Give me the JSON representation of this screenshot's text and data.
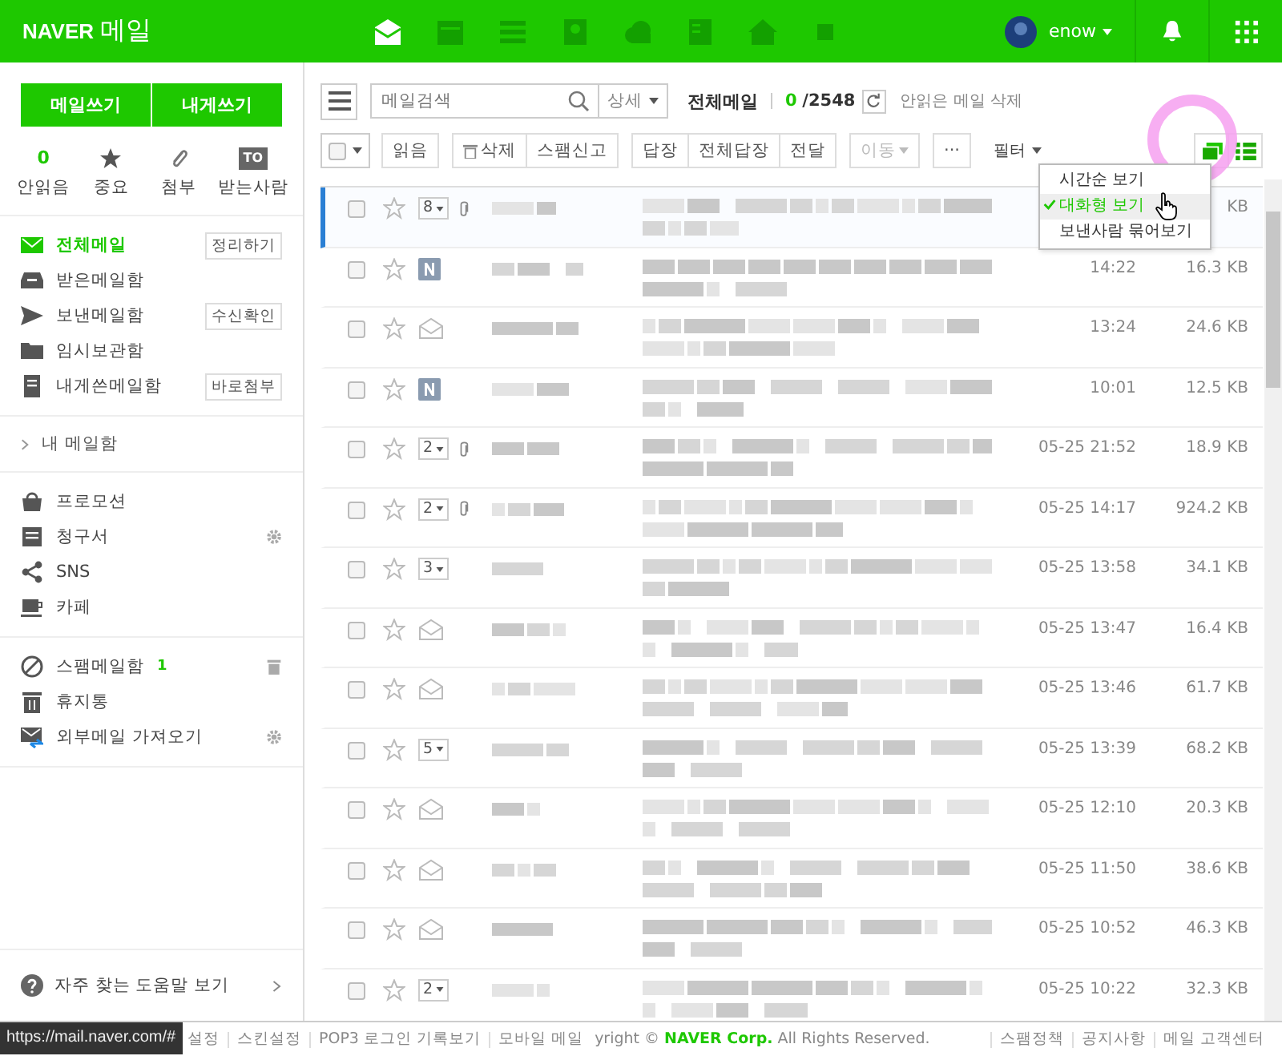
{
  "header": {
    "logo_brand": "NAVER",
    "logo_service": "메일",
    "apps": [
      {
        "kind": "mail",
        "selected": true
      },
      {
        "kind": "calendar",
        "selected": false
      },
      {
        "kind": "list",
        "selected": false
      },
      {
        "kind": "contacts",
        "selected": false
      },
      {
        "kind": "cloud",
        "selected": false
      },
      {
        "kind": "memo",
        "selected": false
      },
      {
        "kind": "home",
        "selected": false
      },
      {
        "kind": "more",
        "selected": false
      }
    ],
    "user": "enow"
  },
  "sidebar": {
    "compose": [
      "메일쓰기",
      "내게쓰기"
    ],
    "counters": [
      {
        "kind": "count",
        "value": "0",
        "label": "안읽음"
      },
      {
        "kind": "star",
        "label": "중요"
      },
      {
        "kind": "clip",
        "label": "첨부"
      },
      {
        "kind": "to",
        "value": "TO",
        "label": "받는사람"
      }
    ],
    "folders": [
      {
        "kind": "all",
        "label": "전체메일",
        "selected": true,
        "action": "정리하기"
      },
      {
        "kind": "inbox",
        "label": "받은메일함",
        "selected": false
      },
      {
        "kind": "sent",
        "label": "보낸메일함",
        "selected": false,
        "action": "수신확인"
      },
      {
        "kind": "draft",
        "label": "임시보관함",
        "selected": false
      },
      {
        "kind": "self",
        "label": "내게쓴메일함",
        "selected": false,
        "action": "바로첨부"
      }
    ],
    "my_folders": {
      "label": "내 메일함",
      "expanded": false
    },
    "categories": [
      {
        "kind": "bag",
        "label": "프로모션",
        "settings": false
      },
      {
        "kind": "bill",
        "label": "청구서",
        "settings": true
      },
      {
        "kind": "share",
        "label": "SNS",
        "settings": false
      },
      {
        "kind": "cup",
        "label": "카페",
        "settings": false
      }
    ],
    "extra": [
      {
        "kind": "spam",
        "label": "스팸메일함",
        "count": "1",
        "trash": true,
        "settings": false
      },
      {
        "kind": "trash",
        "label": "휴지통",
        "trash": false,
        "settings": false
      },
      {
        "kind": "import",
        "label": "외부메일 가져오기",
        "trash": false,
        "settings": true
      }
    ],
    "help": "자주 찾는 도움말 보기"
  },
  "toolbar": {
    "search_placeholder": "메일검색",
    "detail": "상세",
    "folder": "전체메일",
    "unread": "0",
    "total": "/2548",
    "delete_unread": "안읽은 메일 삭제",
    "actions": [
      {
        "kind": "plain",
        "label": "읽음",
        "disabled": false
      },
      {
        "kind": "trash",
        "label": "삭제",
        "disabled": false
      },
      {
        "kind": "plain",
        "label": "스팸신고",
        "disabled": false
      },
      {
        "kind": "plain",
        "label": "답장",
        "disabled": false
      },
      {
        "kind": "plain",
        "label": "전체답장",
        "disabled": false
      },
      {
        "kind": "plain",
        "label": "전달",
        "disabled": false
      },
      {
        "kind": "menu",
        "label": "이동",
        "disabled": true
      },
      {
        "kind": "plain",
        "label": "···",
        "disabled": false
      }
    ],
    "filter": "필터",
    "views": [
      {
        "kind": "conversation",
        "selected": true
      },
      {
        "kind": "list",
        "selected": false
      }
    ]
  },
  "view_menu": [
    {
      "label": "시간순 보기",
      "selected": false
    },
    {
      "label": "대화형 보기",
      "selected": true
    },
    {
      "label": "보낸사람 묶어보기",
      "selected": false
    }
  ],
  "rows": [
    {
      "kind": "thread",
      "count": "8",
      "attach": true,
      "date": "",
      "size": "KB",
      "selected": true
    },
    {
      "kind": "naver",
      "attach": false,
      "date": "14:22",
      "size": "16.3 KB",
      "selected": false
    },
    {
      "kind": "read",
      "attach": false,
      "date": "13:24",
      "size": "24.6 KB",
      "selected": false
    },
    {
      "kind": "naver",
      "attach": false,
      "date": "10:01",
      "size": "12.5 KB",
      "selected": false
    },
    {
      "kind": "thread",
      "count": "2",
      "attach": true,
      "date": "05-25 21:52",
      "size": "18.9 KB",
      "selected": false
    },
    {
      "kind": "thread",
      "count": "2",
      "attach": true,
      "date": "05-25 14:17",
      "size": "924.2 KB",
      "selected": false
    },
    {
      "kind": "thread",
      "count": "3",
      "attach": false,
      "date": "05-25 13:58",
      "size": "34.1 KB",
      "selected": false
    },
    {
      "kind": "read",
      "attach": false,
      "date": "05-25 13:47",
      "size": "16.4 KB",
      "selected": false
    },
    {
      "kind": "read",
      "attach": false,
      "date": "05-25 13:46",
      "size": "61.7 KB",
      "selected": false
    },
    {
      "kind": "thread",
      "count": "5",
      "attach": false,
      "date": "05-25 13:39",
      "size": "68.2 KB",
      "selected": false
    },
    {
      "kind": "read",
      "attach": false,
      "date": "05-25 12:10",
      "size": "20.3 KB",
      "selected": false
    },
    {
      "kind": "read",
      "attach": false,
      "date": "05-25 11:50",
      "size": "38.6 KB",
      "selected": false
    },
    {
      "kind": "read",
      "attach": false,
      "date": "05-25 10:52",
      "size": "46.3 KB",
      "selected": false
    },
    {
      "kind": "thread",
      "count": "2",
      "attach": false,
      "date": "05-25 10:22",
      "size": "32.3 KB",
      "selected": false
    }
  ],
  "footer": {
    "links": [
      "설정",
      "스킨설정",
      "POP3 로그인 기록보기",
      "모바일 메일"
    ],
    "copyright": "yright © **NAVER Corp.** All Rights Reserved.",
    "right_links": [
      "스팸정책",
      "공지사항",
      "메일 고객센터"
    ]
  },
  "status_url": "https://mail.naver.com/#"
}
